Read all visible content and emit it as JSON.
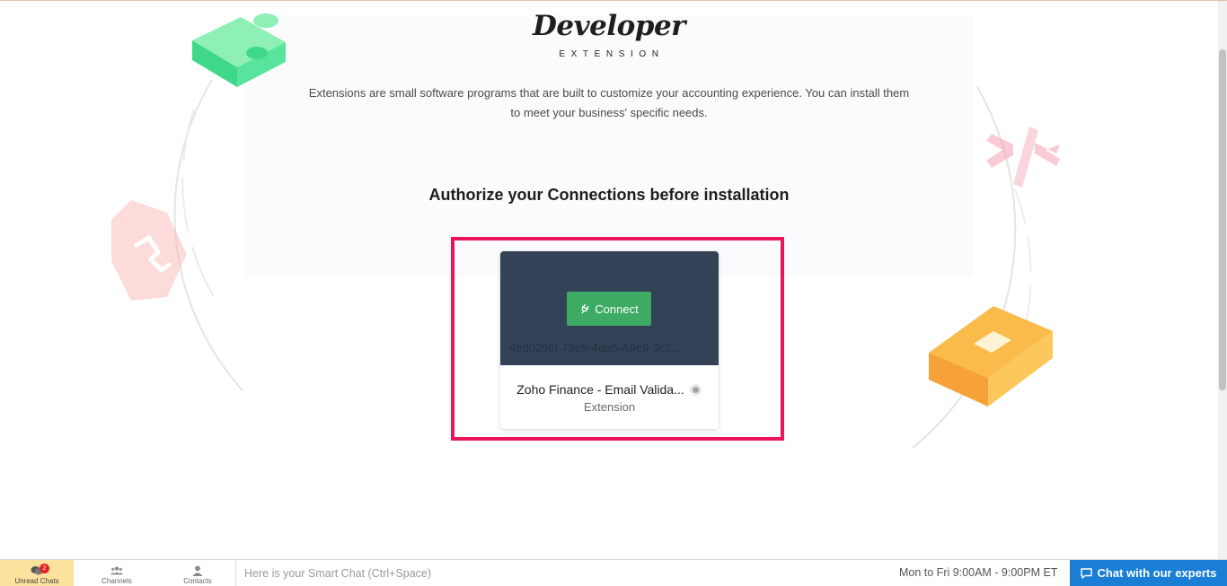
{
  "header": {
    "title": "Developer",
    "subtitle": "EXTENSION",
    "description": "Extensions are small software programs that are built to customize your accounting experience. You can install them to meet your business' specific needs."
  },
  "main": {
    "heading": "Authorize your Connections before installation",
    "card": {
      "connect_label": "Connect",
      "connection_id": "4ed029bf-79e9-4da8-A9e9-3c2...",
      "name": "Zoho Finance - Email Valida...",
      "type": "Extension"
    }
  },
  "colors": {
    "highlight_border": "#ea1458",
    "card_header": "#334256",
    "connect_button": "#3dab63",
    "chat_button": "#1a7fd4",
    "unread_tab": "#fce29d"
  },
  "bottom_bar": {
    "tabs": [
      {
        "label": "Unread Chats",
        "icon": "chat-bubbles-icon",
        "badge": "2"
      },
      {
        "label": "Channels",
        "icon": "users-icon"
      },
      {
        "label": "Contacts",
        "icon": "person-icon"
      }
    ],
    "smart_chat_placeholder": "Here is your Smart Chat (Ctrl+Space)",
    "hours": "Mon to Fri 9:00AM - 9:00PM ET",
    "chat_button": {
      "label": "Chat with our experts",
      "icon": "chat-icon"
    }
  }
}
